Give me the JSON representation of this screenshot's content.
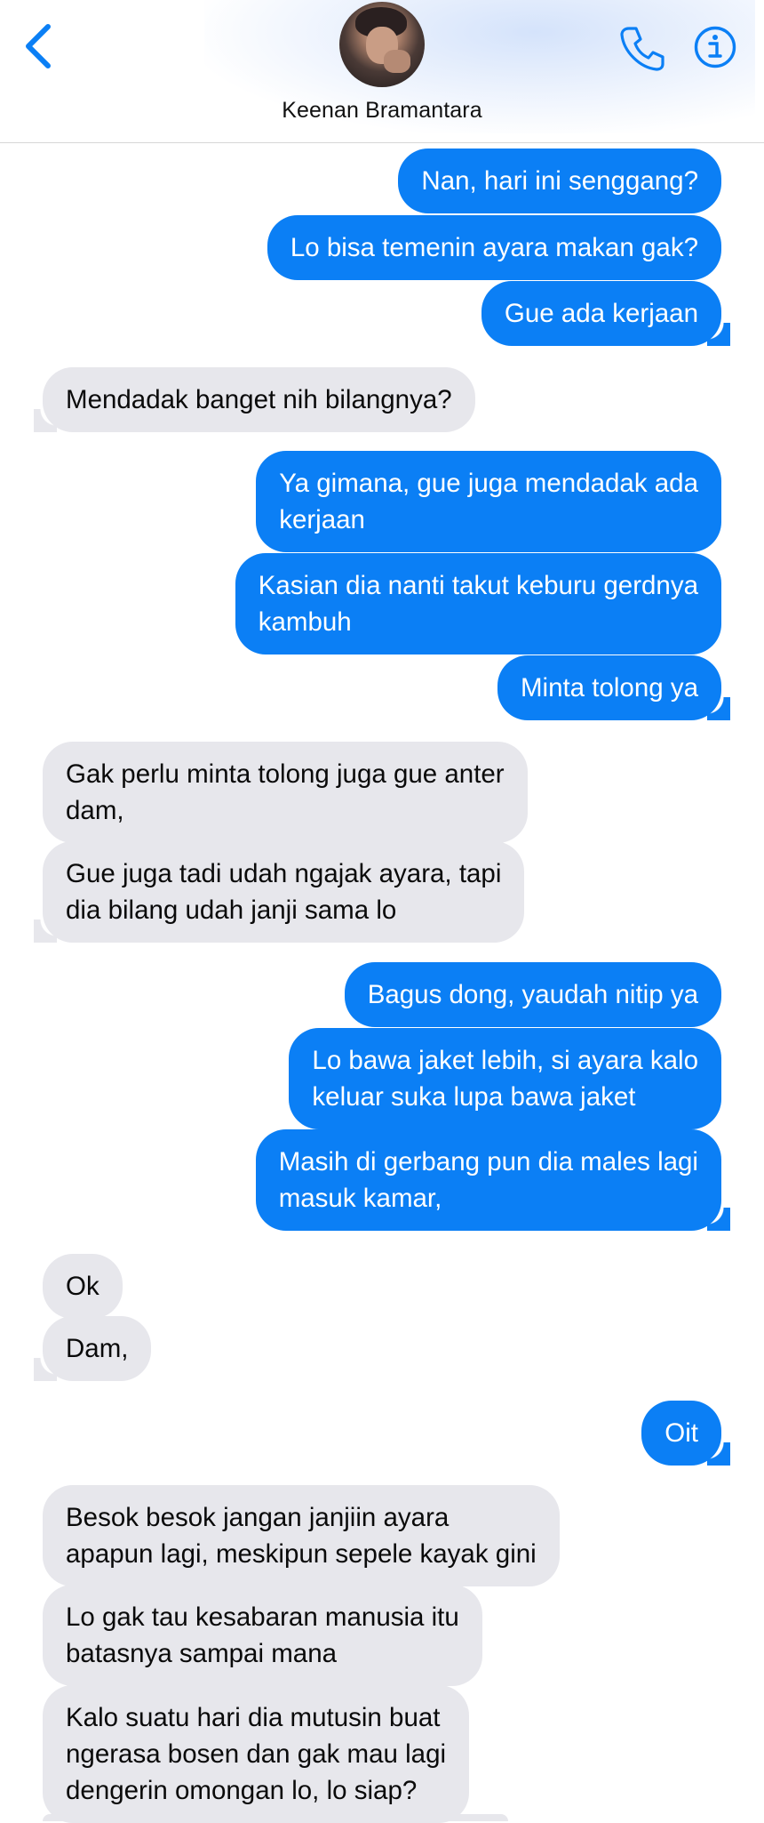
{
  "header": {
    "contact_name": "Keenan Bramantara",
    "back_icon": "chevron-left-icon",
    "call_icon": "phone-icon",
    "info_icon": "info-icon",
    "accent_color": "#0b7ff5"
  },
  "messages": [
    {
      "from": "me",
      "text": "Nan, hari ini senggang?"
    },
    {
      "from": "me",
      "text": "Lo bisa temenin ayara makan gak?"
    },
    {
      "from": "me",
      "text": "Gue ada kerjaan"
    },
    {
      "from": "them",
      "text": "Mendadak banget nih bilangnya?"
    },
    {
      "from": "me",
      "text": "Ya gimana, gue juga mendadak ada\nkerjaan"
    },
    {
      "from": "me",
      "text": "Kasian dia nanti takut keburu gerdnya\nkambuh"
    },
    {
      "from": "me",
      "text": "Minta tolong ya"
    },
    {
      "from": "them",
      "text": "Gak perlu minta tolong juga gue anter\ndam,"
    },
    {
      "from": "them",
      "text": "Gue juga tadi udah ngajak ayara, tapi\ndia bilang udah janji sama lo"
    },
    {
      "from": "me",
      "text": "Bagus dong, yaudah nitip ya"
    },
    {
      "from": "me",
      "text": "Lo bawa jaket lebih, si ayara kalo\nkeluar suka lupa bawa jaket"
    },
    {
      "from": "me",
      "text": "Masih di gerbang pun dia males lagi\nmasuk kamar,"
    },
    {
      "from": "them",
      "text": "Ok"
    },
    {
      "from": "them",
      "text": "Dam,"
    },
    {
      "from": "me",
      "text": "Oit"
    },
    {
      "from": "them",
      "text": "Besok besok jangan janjiin ayara\napapun lagi, meskipun sepele kayak gini"
    },
    {
      "from": "them",
      "text": "Lo gak tau kesabaran manusia itu\nbatasnya sampai mana"
    },
    {
      "from": "them",
      "text": "Kalo suatu hari dia mutusin buat\nngerasa bosen dan gak mau lagi\ndengerin omongan lo, lo siap?"
    }
  ]
}
